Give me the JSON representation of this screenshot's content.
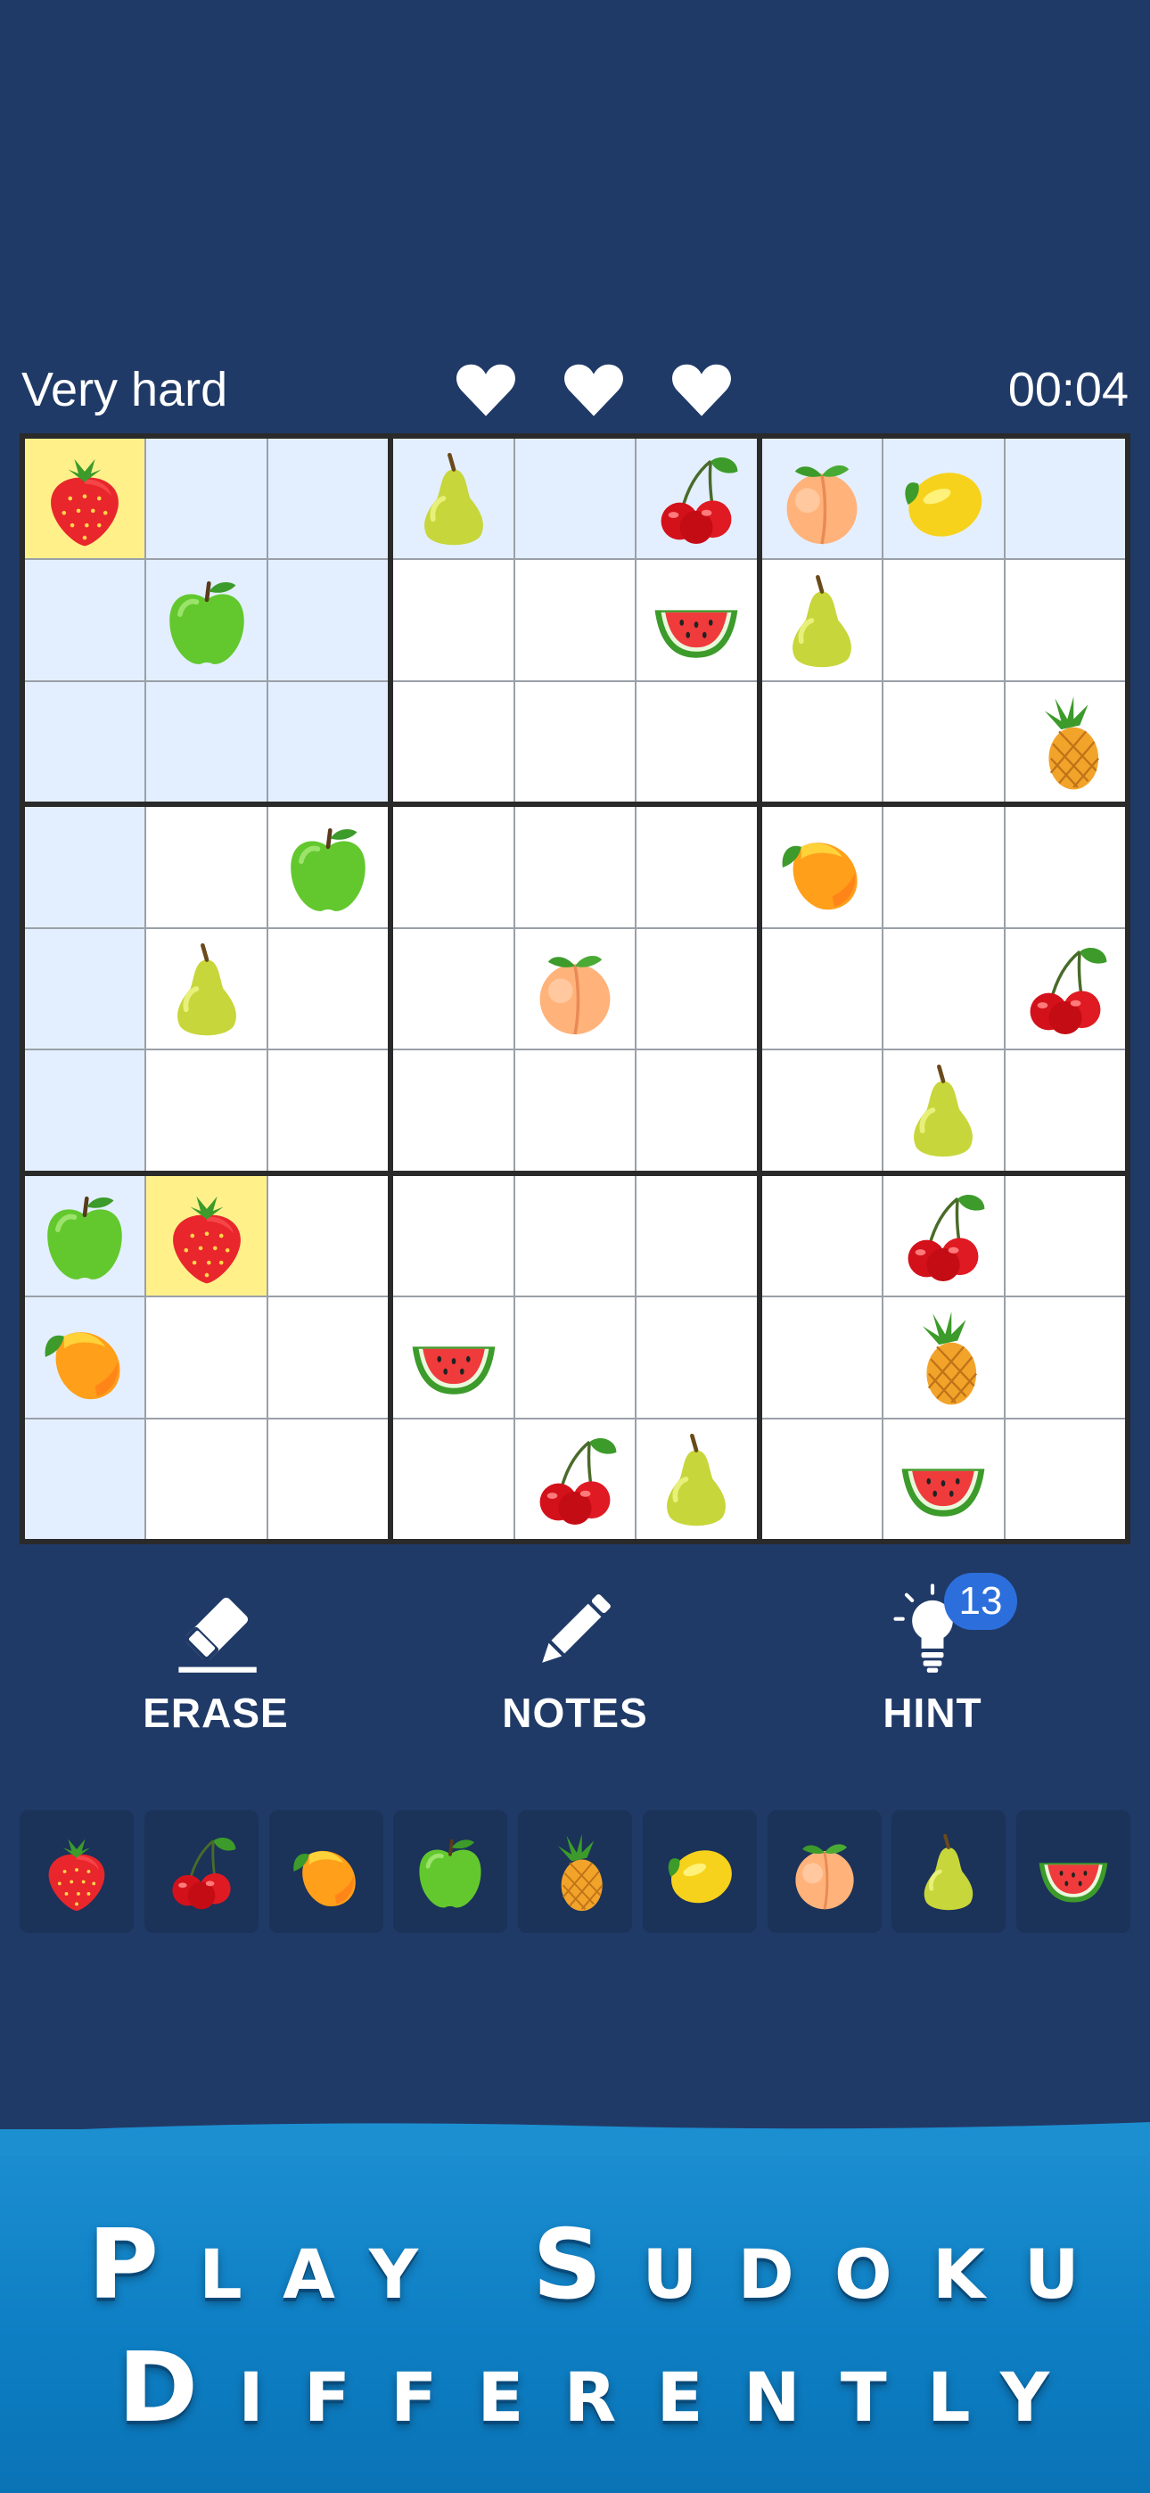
{
  "status": {
    "difficulty": "Very hard",
    "timer": "00:04",
    "lives": 3
  },
  "board": {
    "size": 9,
    "colors": {
      "highlight": "#e3efff",
      "selected": "#fff08a",
      "empty": "#ffffff"
    },
    "highlighted": [
      [
        0,
        0
      ],
      [
        0,
        1
      ],
      [
        0,
        2
      ],
      [
        0,
        3
      ],
      [
        0,
        4
      ],
      [
        0,
        5
      ],
      [
        0,
        6
      ],
      [
        0,
        7
      ],
      [
        0,
        8
      ],
      [
        1,
        0
      ],
      [
        1,
        1
      ],
      [
        1,
        2
      ],
      [
        2,
        0
      ],
      [
        2,
        1
      ],
      [
        2,
        2
      ],
      [
        3,
        0
      ],
      [
        4,
        0
      ],
      [
        5,
        0
      ],
      [
        6,
        0
      ],
      [
        7,
        0
      ],
      [
        8,
        0
      ]
    ],
    "selected": [
      [
        0,
        0
      ],
      [
        6,
        1
      ]
    ],
    "cells": [
      [
        "strawberry",
        "",
        "",
        "pear",
        "",
        "cherry",
        "peach",
        "lemon",
        ""
      ],
      [
        "",
        "apple",
        "",
        "",
        "",
        "watermelon",
        "pear",
        "",
        ""
      ],
      [
        "",
        "",
        "",
        "",
        "",
        "",
        "",
        "",
        "pineapple"
      ],
      [
        "",
        "",
        "apple",
        "",
        "",
        "",
        "mango",
        "",
        ""
      ],
      [
        "",
        "pear",
        "",
        "",
        "peach",
        "",
        "",
        "",
        "cherry"
      ],
      [
        "",
        "",
        "",
        "",
        "",
        "",
        "",
        "pear",
        ""
      ],
      [
        "apple",
        "strawberry",
        "",
        "",
        "",
        "",
        "",
        "cherry",
        ""
      ],
      [
        "mango",
        "",
        "",
        "watermelon",
        "",
        "",
        "",
        "pineapple",
        ""
      ],
      [
        "",
        "",
        "",
        "",
        "cherry",
        "pear",
        "",
        "watermelon",
        ""
      ]
    ]
  },
  "tools": {
    "erase_label": "ERASE",
    "notes_label": "NOTES",
    "hint_label": "HINT",
    "hint_count": "13"
  },
  "palette": [
    "strawberry",
    "cherry",
    "mango",
    "apple",
    "pineapple",
    "lemon",
    "peach",
    "pear",
    "watermelon"
  ],
  "banner": {
    "line1": "Play Sudoku",
    "line2": "Differently"
  }
}
